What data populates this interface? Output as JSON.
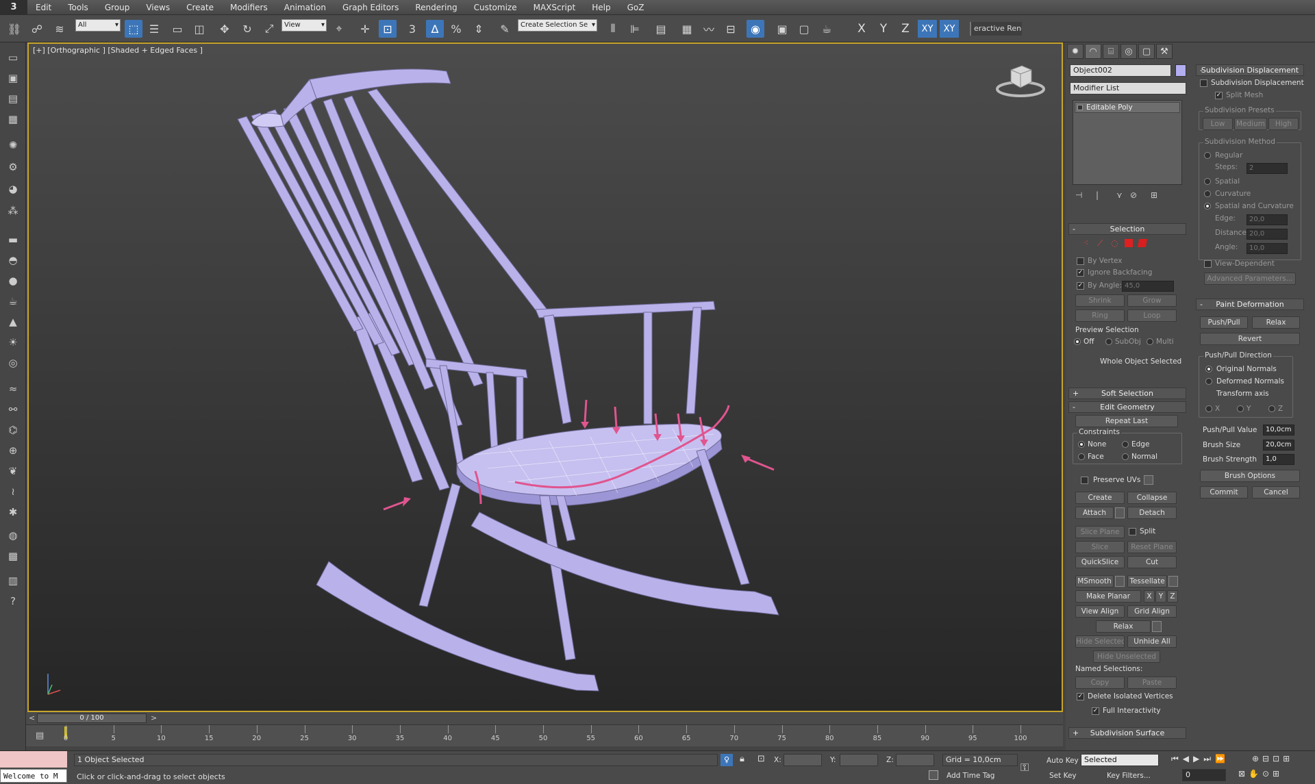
{
  "menu": [
    "Edit",
    "Tools",
    "Group",
    "Views",
    "Create",
    "Modifiers",
    "Animation",
    "Graph Editors",
    "Rendering",
    "Customize",
    "MAXScript",
    "Help",
    "GoZ"
  ],
  "app_logo": "3",
  "toolbar": {
    "filter_select": "All",
    "ref_coord_select": "View",
    "selection_set": "Create Selection Se",
    "snap_label": "3",
    "angle_snap": "∆",
    "percent_snap": "%",
    "axis_x": "X",
    "axis_y": "Y",
    "axis_z": "Z",
    "axis_xy": "XY",
    "axis_xy2": "XY",
    "interactive_render": "eractive Rend"
  },
  "viewport": {
    "label": "[+] [Orthographic ] [Shaded + Edged Faces ]"
  },
  "command_panel": {
    "object_name": "Object002",
    "modifier_list": "Modifier List",
    "stack_item": "Editable Poly",
    "selection": {
      "title": "Selection",
      "by_vertex": "By Vertex",
      "ignore_backfacing": "Ignore Backfacing",
      "by_angle": "By Angle:",
      "by_angle_value": "45,0",
      "shrink": "Shrink",
      "grow": "Grow",
      "ring": "Ring",
      "loop": "Loop",
      "preview_selection": "Preview Selection",
      "off": "Off",
      "subobj": "SubObj",
      "multi": "Multi",
      "status": "Whole Object Selected"
    },
    "soft_selection": "Soft Selection",
    "edit_geometry": {
      "title": "Edit Geometry",
      "repeat_last": "Repeat Last",
      "constraints": "Constraints",
      "none": "None",
      "edge": "Edge",
      "face": "Face",
      "normal": "Normal",
      "preserve_uvs": "Preserve UVs",
      "create": "Create",
      "collapse": "Collapse",
      "attach": "Attach",
      "detach": "Detach",
      "slice_plane": "Slice Plane",
      "split": "Split",
      "slice": "Slice",
      "reset_plane": "Reset Plane",
      "quickslice": "QuickSlice",
      "cut": "Cut",
      "msmooth": "MSmooth",
      "tessellate": "Tessellate",
      "make_planar": "Make Planar",
      "x": "X",
      "y": "Y",
      "z": "Z",
      "view_align": "View Align",
      "grid_align": "Grid Align",
      "relax": "Relax",
      "hide_selected": "Hide Selected",
      "unhide_all": "Unhide All",
      "hide_unselected": "Hide Unselected",
      "named_selections": "Named Selections:",
      "copy": "Copy",
      "paste": "Paste",
      "delete_isolated": "Delete Isolated Vertices",
      "full_interactivity": "Full Interactivity"
    },
    "subdivision_surface": "Subdivision Surface"
  },
  "right_panel": {
    "subdiv_disp": {
      "title": "Subdivision Displacement",
      "checkbox": "Subdivision Displacement",
      "split_mesh": "Split Mesh",
      "presets": "Subdivision Presets",
      "low": "Low",
      "medium": "Medium",
      "high": "High",
      "method": "Subdivision Method",
      "regular": "Regular",
      "steps": "Steps:",
      "steps_val": "2",
      "spatial": "Spatial",
      "curvature": "Curvature",
      "spatial_curv": "Spatial and Curvature",
      "edge": "Edge:",
      "edge_val": "20,0",
      "distance": "Distance:",
      "distance_val": "20,0",
      "angle": "Angle:",
      "angle_val": "10,0",
      "view_dep": "View-Dependent",
      "advanced": "Advanced Parameters..."
    },
    "paint_def": {
      "title": "Paint Deformation",
      "push_pull": "Push/Pull",
      "relax": "Relax",
      "revert": "Revert",
      "direction": "Push/Pull Direction",
      "original": "Original Normals",
      "deformed": "Deformed Normals",
      "transform_axis": "Transform axis",
      "x": "X",
      "y": "Y",
      "z": "Z",
      "push_value": "Push/Pull Value",
      "push_value_val": "10,0cm",
      "brush_size": "Brush Size",
      "brush_size_val": "20,0cm",
      "brush_strength": "Brush Strength",
      "brush_strength_val": "1,0",
      "brush_options": "Brush Options",
      "commit": "Commit",
      "cancel": "Cancel"
    }
  },
  "timeline": {
    "frame": "0 / 100",
    "ticks": [
      "0",
      "5",
      "10",
      "15",
      "20",
      "25",
      "30",
      "35",
      "40",
      "45",
      "50",
      "55",
      "60",
      "65",
      "70",
      "75",
      "80",
      "85",
      "90",
      "95",
      "100"
    ]
  },
  "status": {
    "script": "Welcome to M",
    "selected": "1 Object Selected",
    "prompt": "Click or click-and-drag to select objects",
    "x_label": "X:",
    "y_label": "Y:",
    "z_label": "Z:",
    "grid": "Grid = 10,0cm",
    "add_time_tag": "Add Time Tag",
    "auto_key": "Auto Key",
    "set_key": "Set Key",
    "key_mode": "Selected",
    "key_filters": "Key Filters...",
    "frame_value": "0"
  }
}
